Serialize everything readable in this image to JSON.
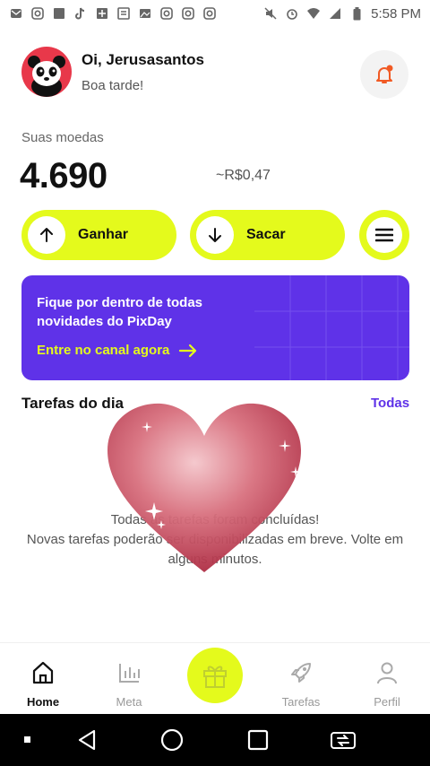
{
  "statusbar": {
    "time": "5:58 PM",
    "notification_icons": [
      "mail-icon",
      "instagram-icon",
      "photo-icon",
      "tiktok-icon",
      "news-icon",
      "news-icon",
      "gallery-icon",
      "instagram-icon",
      "instagram-icon",
      "instagram-icon"
    ],
    "system_icons": [
      "mute-icon",
      "alarm-icon",
      "wifi-icon",
      "signal-icon",
      "battery-icon"
    ]
  },
  "header": {
    "greeting": "Oi, Jerusasantos",
    "subtitle": "Boa tarde!"
  },
  "balance": {
    "label": "Suas moedas",
    "coins": "4.690",
    "reais": "~R$0,47"
  },
  "actions": {
    "earn_label": "Ganhar",
    "withdraw_label": "Sacar"
  },
  "banner": {
    "text": "Fique por dentro de todas novidades do PixDay",
    "cta": "Entre no canal agora"
  },
  "tasks": {
    "title": "Tarefas do dia",
    "see_all": "Todas",
    "empty_line1": "Todas as tarefas foram concluídas!",
    "empty_line2": "Novas tarefas poderão ser disponibilizadas em breve. Volte em alguns minutos."
  },
  "nav": {
    "home": "Home",
    "meta": "Meta",
    "tarefas": "Tarefas",
    "perfil": "Perfil"
  },
  "colors": {
    "accent": "#e4fa1c",
    "primary": "#5f32e8",
    "avatar_bg": "#e8384a",
    "bell": "#f15a24"
  }
}
